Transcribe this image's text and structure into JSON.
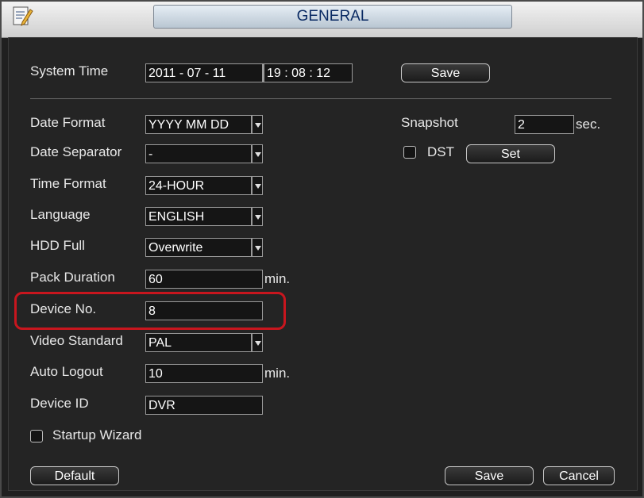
{
  "window": {
    "title": "GENERAL"
  },
  "system_time": {
    "label": "System Time",
    "date": "2011  - 07 - 11",
    "time": "19 : 08 : 12",
    "save_label": "Save"
  },
  "left_fields": {
    "date_format": {
      "label": "Date Format",
      "value": "YYYY MM DD"
    },
    "date_separator": {
      "label": "Date Separator",
      "value": "-"
    },
    "time_format": {
      "label": "Time Format",
      "value": "24-HOUR"
    },
    "language": {
      "label": "Language",
      "value": "ENGLISH"
    },
    "hdd_full": {
      "label": "HDD Full",
      "value": "Overwrite"
    },
    "pack_duration": {
      "label": "Pack Duration",
      "value": "60",
      "unit": "min."
    },
    "device_no": {
      "label": "Device No.",
      "value": "8"
    },
    "video_standard": {
      "label": "Video Standard",
      "value": "PAL"
    },
    "auto_logout": {
      "label": "Auto Logout",
      "value": "10",
      "unit": "min."
    },
    "device_id": {
      "label": "Device ID",
      "value": "DVR"
    }
  },
  "startup_wizard": {
    "label": "Startup Wizard",
    "checked": false
  },
  "right_fields": {
    "snapshot": {
      "label": "Snapshot",
      "value": "2",
      "unit": "sec."
    },
    "dst": {
      "label": "DST",
      "checked": false,
      "set_label": "Set"
    }
  },
  "footer": {
    "default_label": "Default",
    "save_label": "Save",
    "cancel_label": "Cancel"
  },
  "colors": {
    "highlight": "#c8161e",
    "title_text": "#0a2a63"
  }
}
